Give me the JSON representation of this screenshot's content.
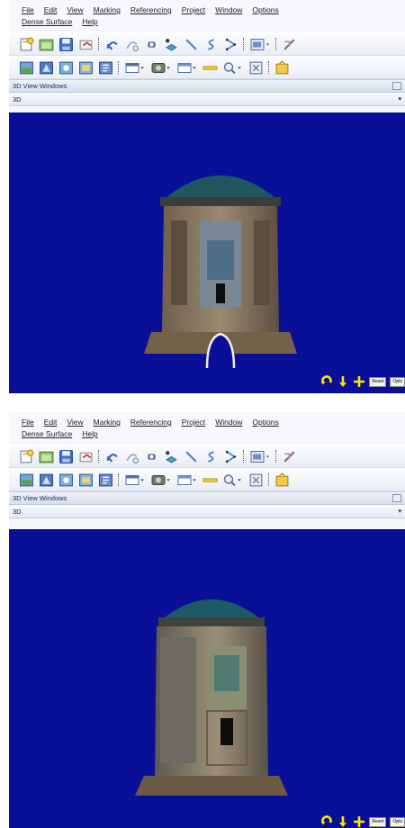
{
  "menu": {
    "file": "File",
    "edit": "Edit",
    "view": "View",
    "marking": "Marking",
    "referencing": "Referencing",
    "project": "Project",
    "window": "Window",
    "options": "Options",
    "dense_surface": "Dense Surface",
    "help": "Help"
  },
  "window": {
    "title": "3D View Windows",
    "view_name": "3D"
  },
  "viewport": {
    "background": "#0a0f97",
    "nav_accent": "#ffe600",
    "reset_label": "Reset",
    "opts_label": "Opts"
  },
  "toolbar1_icons": [
    "new-project-icon",
    "open-project-icon",
    "save-icon",
    "undo-icon",
    "select-icon",
    "lasso-icon",
    "point-icon",
    "marker-icon",
    "line-icon",
    "curve-icon",
    "polyline-icon",
    "display-options-icon",
    "crop-icon"
  ],
  "toolbar2_icons": [
    "view-2d-icon",
    "view-3d-icon",
    "photo-icon",
    "orthophoto-icon",
    "report-icon",
    "table-dropdown-icon",
    "mesh-dropdown-icon",
    "panel-dropdown-icon",
    "measure-line-icon",
    "zoom-dropdown-icon",
    "fit-icon",
    "export-icon"
  ]
}
